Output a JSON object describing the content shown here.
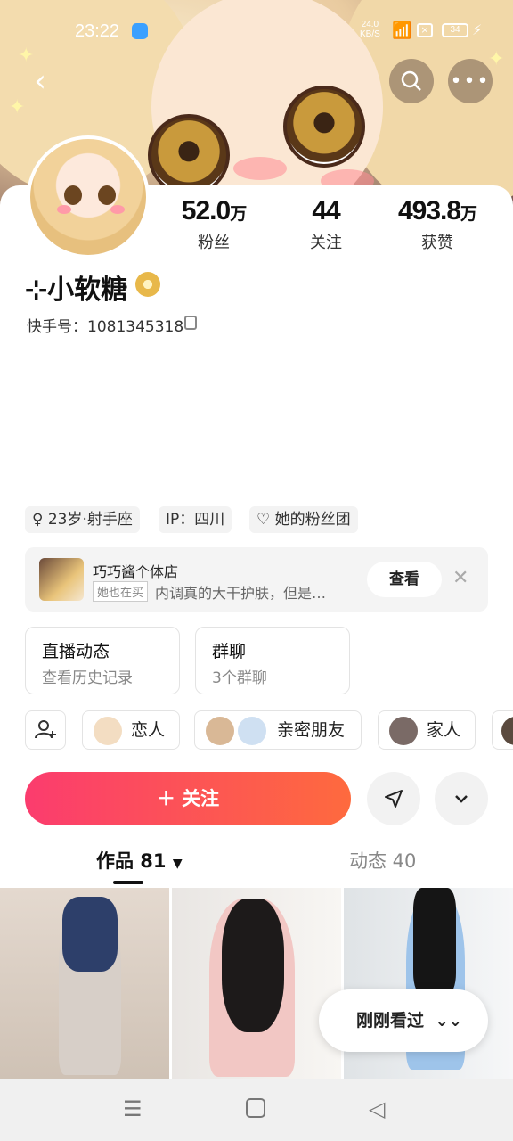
{
  "status_bar": {
    "time": "23:22",
    "net_speed": "24.0",
    "net_unit": "KB/S",
    "battery": "34"
  },
  "profile": {
    "nickname": "⊹小软糖",
    "kuaishou_id_label": "快手号：1081345318",
    "stats": [
      {
        "value": "52.0",
        "unit": "万",
        "label": "粉丝"
      },
      {
        "value": "44",
        "unit": "",
        "label": "关注"
      },
      {
        "value": "493.8",
        "unit": "万",
        "label": "获赞"
      }
    ],
    "tags": [
      "♀ 23岁·射手座",
      "IP：四川",
      "她的粉丝团"
    ]
  },
  "shop": {
    "name": "巧巧酱个体店",
    "sub_tag": "她也在买",
    "desc": "内调真的大干护肤，但是…",
    "view_label": "查看"
  },
  "boxes": [
    {
      "title": "直播动态",
      "sub": "查看历史记录"
    },
    {
      "title": "群聊",
      "sub": "3个群聊"
    }
  ],
  "chips": [
    "恋人",
    "亲密朋友",
    "家人"
  ],
  "follow_label": "＋ 关注",
  "tabs": {
    "works": "作品 81",
    "moments": "动态 40"
  },
  "seen_label": "刚刚看过",
  "colors": {
    "accent_start": "#fb3c6e",
    "accent_end": "#fe6a3e"
  }
}
